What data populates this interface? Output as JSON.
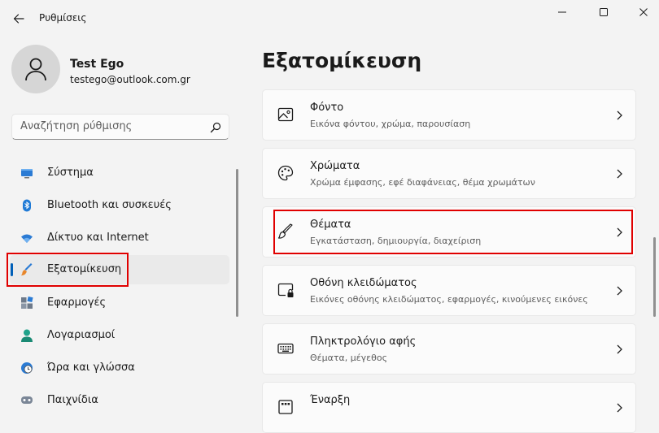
{
  "window": {
    "title": "Ρυθμίσεις"
  },
  "profile": {
    "name": "Test Ego",
    "email": "testego@outlook.com.gr"
  },
  "search": {
    "placeholder": "Αναζήτηση ρύθμισης"
  },
  "sidebar": {
    "items": [
      {
        "label": "Σύστημα",
        "icon": "system-icon"
      },
      {
        "label": "Bluetooth και συσκευές",
        "icon": "bluetooth-icon"
      },
      {
        "label": "Δίκτυο και Internet",
        "icon": "wifi-icon"
      },
      {
        "label": "Εξατομίκευση",
        "icon": "brush-icon",
        "active": true
      },
      {
        "label": "Εφαρμογές",
        "icon": "apps-icon"
      },
      {
        "label": "Λογαριασμοί",
        "icon": "person-icon"
      },
      {
        "label": "Ώρα και γλώσσα",
        "icon": "globe-clock-icon"
      },
      {
        "label": "Παιχνίδια",
        "icon": "gaming-icon"
      }
    ]
  },
  "main": {
    "title": "Εξατομίκευση",
    "cards": [
      {
        "title": "Φόντο",
        "subtitle": "Εικόνα φόντου, χρώμα, παρουσίαση",
        "icon": "image-icon"
      },
      {
        "title": "Χρώματα",
        "subtitle": "Χρώμα έμφασης, εφέ διαφάνειας, θέμα χρωμάτων",
        "icon": "palette-icon"
      },
      {
        "title": "Θέματα",
        "subtitle": "Εγκατάσταση, δημιουργία, διαχείριση",
        "icon": "brush-outline-icon"
      },
      {
        "title": "Οθόνη κλειδώματος",
        "subtitle": "Εικόνες οθόνης κλειδώματος, εφαρμογές, κινούμενες εικόνες",
        "icon": "lock-screen-icon"
      },
      {
        "title": "Πληκτρολόγιο αφής",
        "subtitle": "Θέματα, μέγεθος",
        "icon": "keyboard-icon"
      },
      {
        "title": "Έναρξη",
        "subtitle": "",
        "icon": "start-icon"
      }
    ]
  },
  "colors": {
    "accent": "#005fb8",
    "highlight": "#e00000"
  }
}
